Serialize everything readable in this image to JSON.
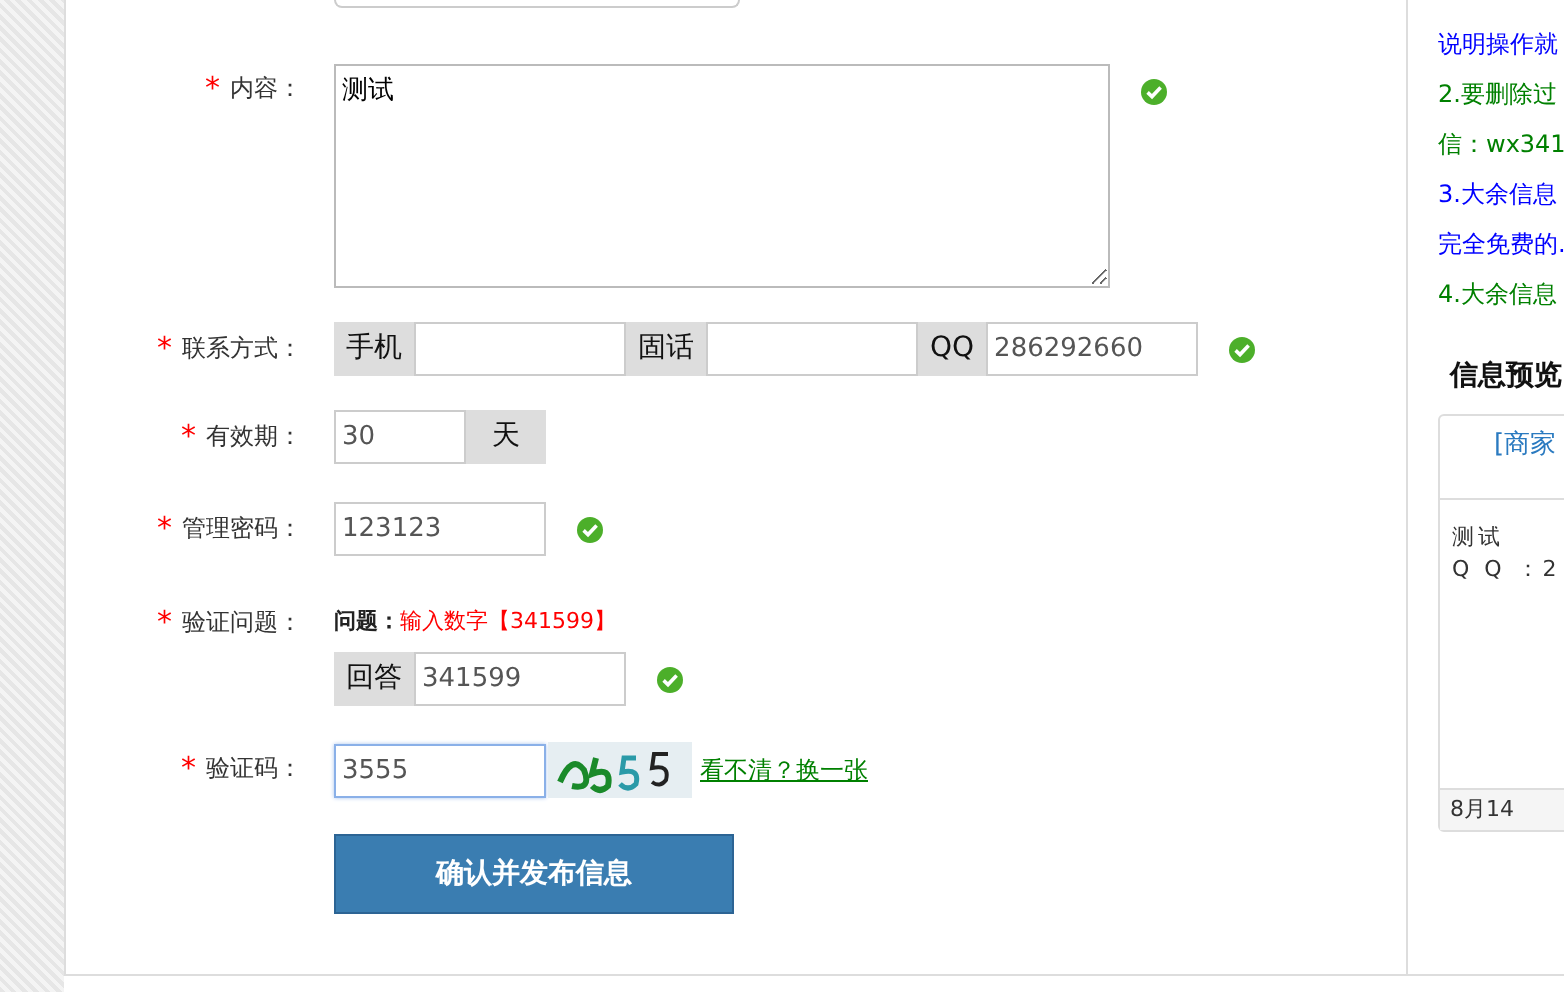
{
  "form": {
    "rows": [
      {
        "kind": "textarea",
        "mark": "*",
        "label": "内容：",
        "value": "测试",
        "valid": true
      },
      {
        "kind": "contact",
        "mark": "*",
        "label": "联系方式：",
        "parts": [
          {
            "prefix": "手机"
          },
          {
            "prefix": "固话"
          },
          {
            "prefix": "QQ",
            "value": "286292660"
          }
        ],
        "valid": true
      },
      {
        "kind": "suffix",
        "mark": "*",
        "label": "有效期：",
        "value": "30",
        "suffix": "天"
      },
      {
        "kind": "input",
        "mark": "*",
        "label": "管理密码：",
        "value": "123123",
        "valid": true
      },
      {
        "kind": "question",
        "mark": "*",
        "label": "验证问题：",
        "question_label": "问题：",
        "question": "输入数字【341599】",
        "prefix": "回答",
        "value": "341599",
        "valid": true
      },
      {
        "kind": "captcha",
        "mark": "*",
        "label": "验证码：",
        "value": "3555",
        "focused": true,
        "link": "看不清？换一张"
      }
    ],
    "submit": "确认并发布信息"
  },
  "sidebar": {
    "notes": [
      {
        "text": "说明操作就",
        "color": "#0000ff"
      },
      {
        "text": "2.要删除过",
        "color": "#008000"
      },
      {
        "text": "信：wx341",
        "color": "#008000"
      },
      {
        "text": "3.大余信息",
        "color": "#0000ff"
      },
      {
        "text": "完全免费的.",
        "color": "#0000ff"
      },
      {
        "text": "4.大余信息",
        "color": "#008000"
      }
    ],
    "preview": {
      "title": "信息预览",
      "header": "[商家",
      "lines": [
        "测试",
        "Q Q ：2"
      ],
      "footer": "8月14"
    }
  }
}
